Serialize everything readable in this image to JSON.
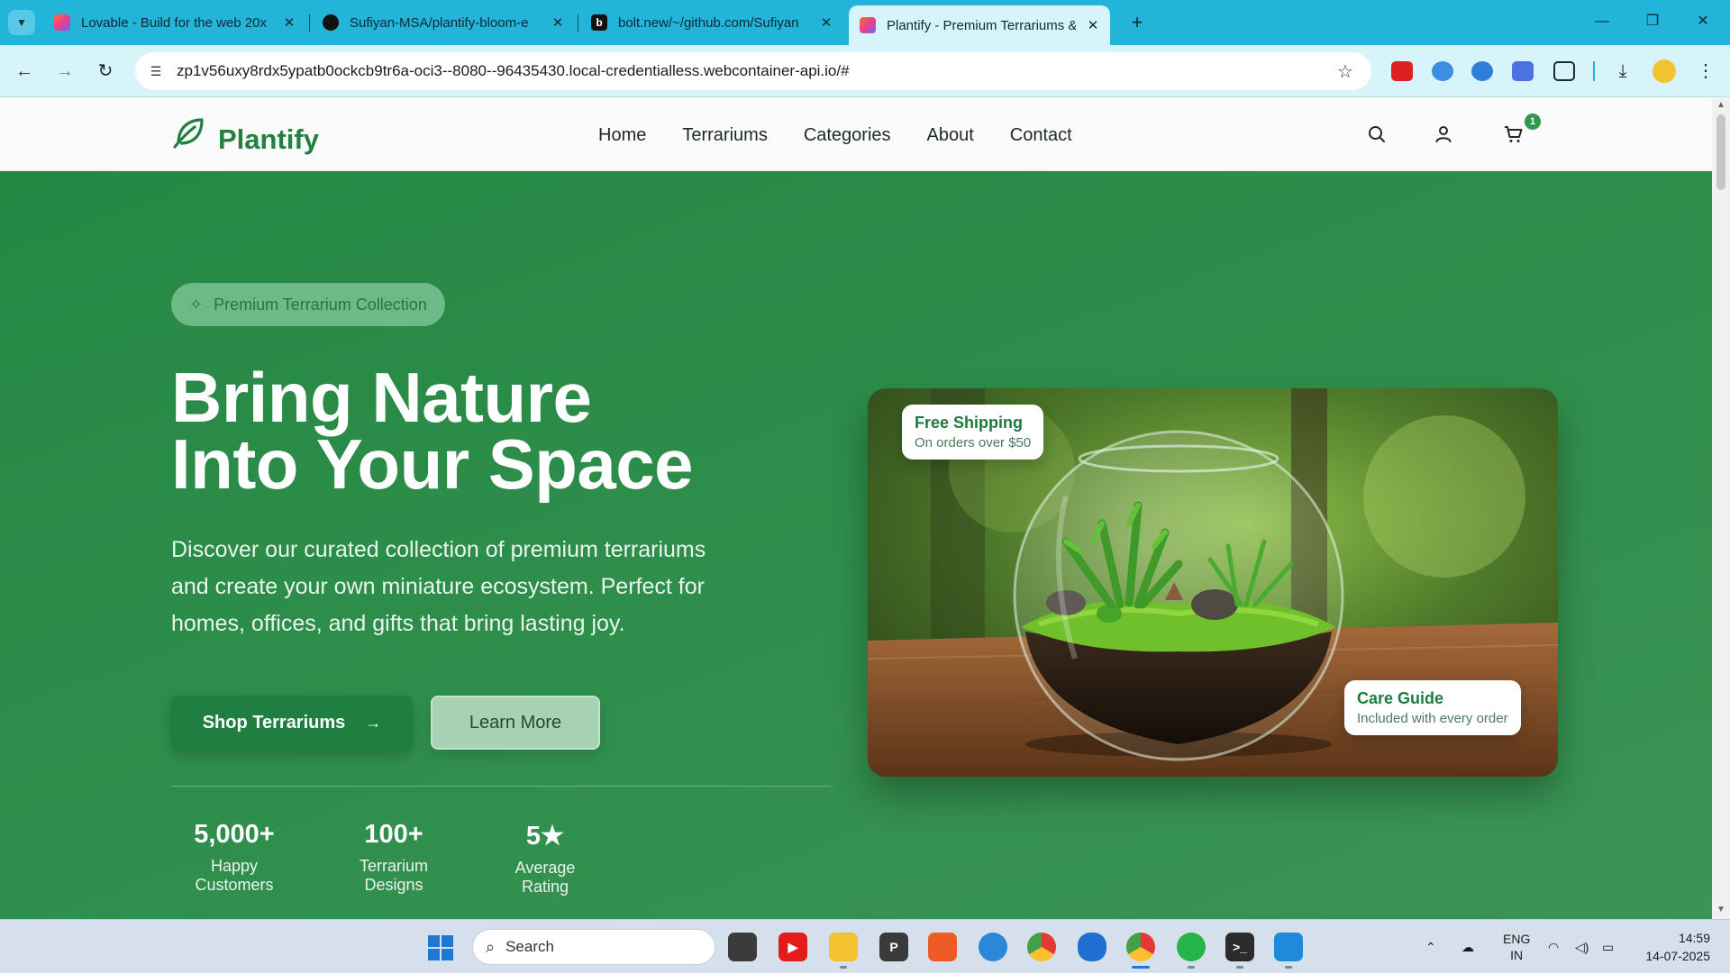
{
  "browser": {
    "tabs": [
      {
        "title": "Lovable - Build for the web 20x",
        "favicon_color": "#e8408a"
      },
      {
        "title": "Sufiyan-MSA/plantify-bloom-e",
        "favicon_color": "#111111"
      },
      {
        "title": "bolt.new/~/github.com/Sufiyan",
        "favicon_color": "#111111"
      },
      {
        "title": "Plantify - Premium Terrariums &",
        "favicon_color": "#e8408a"
      }
    ],
    "url": "zp1v56uxy8rdx5ypatb0ockcb9tr6a-oci3--8080--96435430.local-credentialless.webcontainer-api.io/#"
  },
  "site": {
    "brand": "Plantify",
    "nav": [
      "Home",
      "Terrariums",
      "Categories",
      "About",
      "Contact"
    ],
    "cart_count": "1"
  },
  "hero": {
    "badge": "Premium Terrarium Collection",
    "title_line1": "Bring Nature",
    "title_line2": "Into Your Space",
    "description": "Discover our curated collection of premium terrariums and create your own miniature ecosystem. Perfect for homes, offices, and gifts that bring lasting joy.",
    "primary_cta": "Shop Terrariums",
    "secondary_cta": "Learn More",
    "stats": [
      {
        "value": "5,000+",
        "label": "Happy Customers"
      },
      {
        "value": "100+",
        "label": "Terrarium Designs"
      },
      {
        "value": "5★",
        "label": "Average Rating"
      }
    ],
    "card_shipping": {
      "title": "Free Shipping",
      "subtitle": "On orders over $50"
    },
    "card_care": {
      "title": "Care Guide",
      "subtitle": "Included with every order"
    }
  },
  "taskbar": {
    "search_placeholder": "Search",
    "language": "ENG",
    "region": "IN",
    "time": "14:59",
    "date": "14-07-2025"
  },
  "colors": {
    "brand_green": "#23803f",
    "hero_bg": "#2f8e4b",
    "browser_accent": "#23b5d9"
  }
}
